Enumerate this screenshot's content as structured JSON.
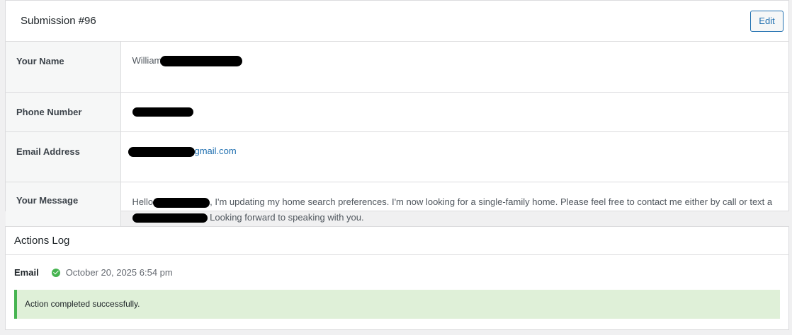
{
  "submission": {
    "title": "Submission #96",
    "edit_label": "Edit",
    "fields": [
      {
        "label": "Your Name",
        "value_prefix": "William"
      },
      {
        "label": "Phone Number"
      },
      {
        "label": "Email Address",
        "value_suffix": "gmail.com"
      },
      {
        "label": "Your Message",
        "part1": "Hello",
        "part2": ", I'm updating my home search preferences. I'm now looking for a single-family home. Please feel free to contact me either by call or text a",
        "part3": " Looking forward to speaking with you."
      }
    ]
  },
  "actions_log": {
    "title": "Actions Log",
    "entry": {
      "action": "Email",
      "timestamp": "October 20, 2025 6:54 pm",
      "status_icon": "check-circle-icon",
      "message": "Action completed successfully."
    }
  },
  "colors": {
    "accent": "#2271b1",
    "success": "#46b450",
    "success_bg": "#dff0d8"
  }
}
